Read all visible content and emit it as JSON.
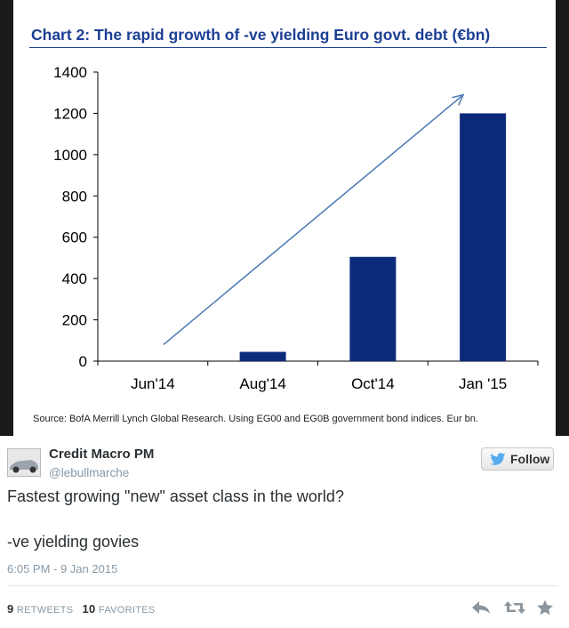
{
  "chart_data": {
    "type": "bar",
    "title": "Chart 2: The rapid growth of -ve yielding Euro govt. debt (€bn)",
    "categories": [
      "Jun'14",
      "Aug'14",
      "Oct'14",
      "Jan '15"
    ],
    "values": [
      0,
      45,
      505,
      1200
    ],
    "ylim": [
      0,
      1400
    ],
    "yticks": [
      "0",
      "200",
      "400",
      "600",
      "800",
      "1000",
      "1200",
      "1400"
    ],
    "xlabel": "",
    "ylabel": "",
    "bar_color": "#0b2a7a",
    "source": "Source: BofA Merrill Lynch Global Research. Using EG00 and EG0B government bond indices. Eur bn."
  },
  "tweet": {
    "author_name": "Credit Macro PM",
    "author_handle": "@lebullmarche",
    "follow_label": "Follow",
    "text_line1": "Fastest growing \"new\" asset class in the world?",
    "text_line2": "-ve yielding govies",
    "timestamp": "6:05 PM - 9 Jan 2015",
    "retweets_count": "9",
    "retweets_label": "RETWEETS",
    "favorites_count": "10",
    "favorites_label": "FAVORITES",
    "icons": [
      "reply-icon",
      "retweet-icon",
      "favorite-icon",
      "twitter-bird-icon"
    ]
  }
}
